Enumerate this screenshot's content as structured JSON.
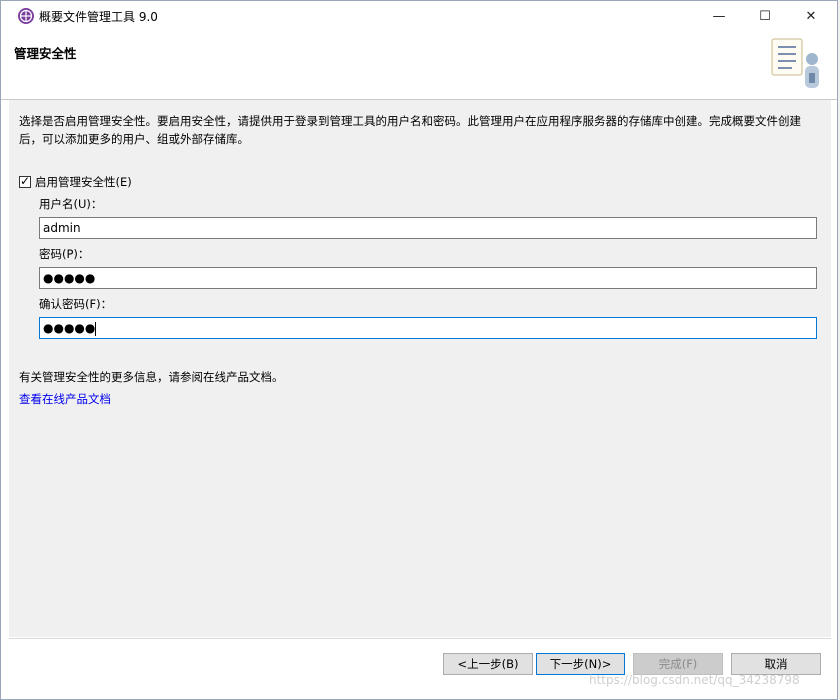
{
  "window": {
    "title": "概要文件管理工具 9.0",
    "controls": {
      "minimize": "—",
      "maximize": "☐",
      "close": "✕"
    }
  },
  "header": {
    "title": "管理安全性"
  },
  "description": "选择是否启用管理安全性。要启用安全性，请提供用于登录到管理工具的用户名和密码。此管理用户在应用程序服务器的存储库中创建。完成概要文件创建后，可以添加更多的用户、组或外部存储库。",
  "enable_security": {
    "label": "启用管理安全性(E)",
    "checked": true
  },
  "fields": {
    "username": {
      "label": "用户名(U)：",
      "value": "admin"
    },
    "password": {
      "label": "密码(P)：",
      "value": "●●●●●"
    },
    "confirm": {
      "label": "确认密码(F)：",
      "value": "●●●●●"
    }
  },
  "info": {
    "text": "有关管理安全性的更多信息，请参阅在线产品文档。",
    "link": "查看在线产品文档"
  },
  "buttons": {
    "back": "<上一步(B)",
    "next": "下一步(N)>",
    "finish": "完成(F)",
    "cancel": "取消"
  },
  "watermark": "https://blog.csdn.net/qq_34238798",
  "colors": {
    "accent": "#0078d7",
    "link": "#0000ee",
    "icon": "#7b3fa0"
  }
}
